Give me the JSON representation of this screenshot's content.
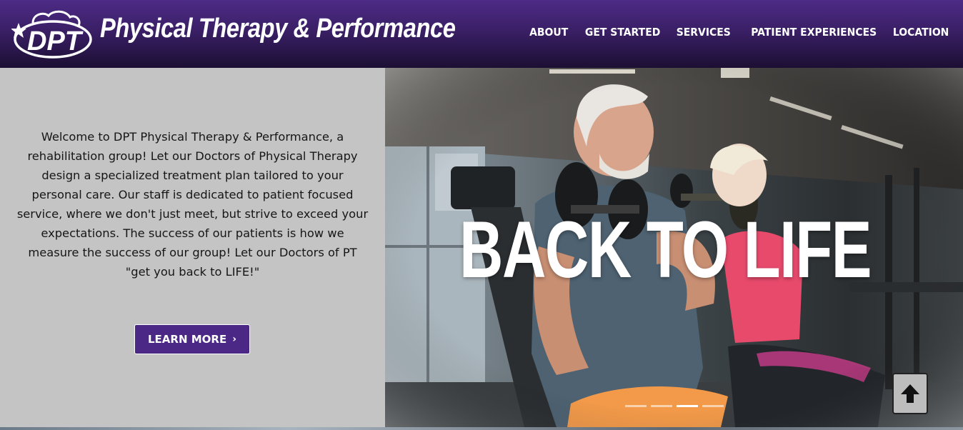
{
  "header": {
    "logo_icon": "dpt-logo-icon",
    "brand": "Physical Therapy & Performance",
    "nav": [
      {
        "label": "ABOUT"
      },
      {
        "label": "GET STARTED"
      },
      {
        "label": "SERVICES"
      },
      {
        "label": "PATIENT EXPERIENCES"
      },
      {
        "label": "LOCATION"
      }
    ]
  },
  "intro": {
    "text": "Welcome to DPT Physical Therapy & Performance, a rehabilitation group! Let our Doctors of Physical Therapy design a specialized treatment plan tailored to your personal care. Our staff is dedicated to patient focused service, where we don't just meet, but strive to exceed your expectations. The success of our patients is how we measure the success of our group! Let our Doctors of PT \"get you back to LIFE!\"",
    "button_label": "LEARN MORE",
    "button_icon": "chevron-right-icon"
  },
  "hero": {
    "title": "BACK TO LIFE",
    "slides_total": 4,
    "active_slide": 3
  },
  "colors": {
    "brand_purple": "#4b2885",
    "header_dark": "#1c0f33",
    "panel_gray": "#c4c4c4"
  },
  "scroll_top_icon": "arrow-up-icon"
}
